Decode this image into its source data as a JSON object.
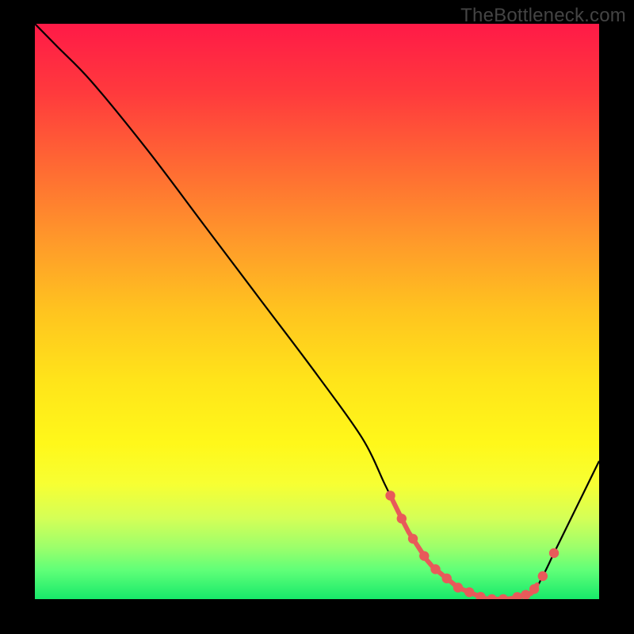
{
  "watermark": "TheBottleneck.com",
  "chart_data": {
    "type": "line",
    "title": "",
    "xlabel": "",
    "ylabel": "",
    "xlim": [
      0,
      100
    ],
    "ylim": [
      0,
      100
    ],
    "x": [
      0,
      4,
      10,
      20,
      30,
      40,
      50,
      58,
      62,
      64,
      66,
      70,
      75,
      80,
      84,
      88,
      90,
      92,
      95,
      100
    ],
    "values": [
      100,
      96,
      90,
      78,
      65,
      52,
      39,
      28,
      20,
      16,
      12,
      6,
      2,
      0,
      0,
      1,
      4,
      8,
      14,
      24
    ],
    "highlight_x_range": [
      63,
      89
    ],
    "markers_x": [
      63,
      65,
      67,
      69,
      71,
      73,
      75,
      77,
      79,
      81,
      83,
      85.5,
      87,
      88.5,
      90,
      92
    ]
  }
}
